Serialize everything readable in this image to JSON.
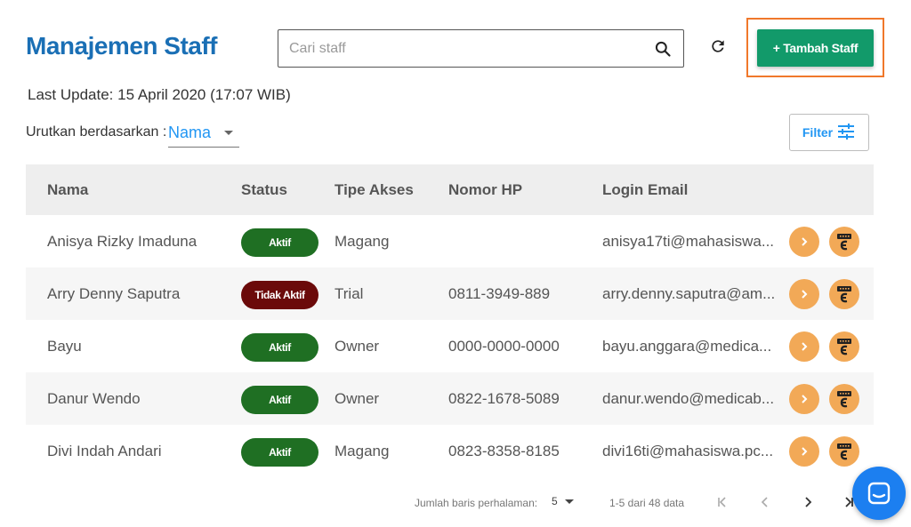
{
  "header": {
    "title": "Manajemen Staff",
    "search_placeholder": "Cari staff",
    "add_button": "+ Tambah Staff"
  },
  "last_update": "Last Update: 15 April 2020 (17:07 WIB)",
  "sort": {
    "label": "Urutkan berdasarkan :",
    "value": "Nama"
  },
  "filter_label": "Filter",
  "table": {
    "columns": [
      "Nama",
      "Status",
      "Tipe Akses",
      "Nomor HP",
      "Login Email"
    ],
    "rows": [
      {
        "name": "Anisya Rizky Imaduna",
        "status": "Aktif",
        "status_type": "active",
        "akses": "Magang",
        "hp": "",
        "email": "anisya17ti@mahasiswa..."
      },
      {
        "name": "Arry Denny Saputra",
        "status": "Tidak Aktif",
        "status_type": "inactive",
        "akses": "Trial",
        "hp": "0811-3949-889",
        "email": "arry.denny.saputra@am..."
      },
      {
        "name": "Bayu",
        "status": "Aktif",
        "status_type": "active",
        "akses": "Owner",
        "hp": "0000-0000-0000",
        "email": "bayu.anggara@medica..."
      },
      {
        "name": "Danur Wendo",
        "status": "Aktif",
        "status_type": "active",
        "akses": "Owner",
        "hp": "0822-1678-5089",
        "email": "danur.wendo@medicab..."
      },
      {
        "name": "Divi Indah Andari",
        "status": "Aktif",
        "status_type": "active",
        "akses": "Magang",
        "hp": "0823-8358-8185",
        "email": "divi16ti@mahasiswa.pc..."
      }
    ]
  },
  "pagination": {
    "rows_label": "Jumlah baris perhalaman:",
    "rows_value": "5",
    "range": "1-5 dari 48 data"
  },
  "colors": {
    "title": "#1a6fb5",
    "primary_button": "#129a6a",
    "highlight": "#f0782b",
    "active_badge": "#1f6f23",
    "inactive_badge": "#6b0a0a",
    "action_button": "#f2a957",
    "link": "#2196f3"
  },
  "icons": [
    "search-icon",
    "refresh-icon",
    "filter-icon",
    "chevron-right-icon",
    "edc-icon",
    "first-page-icon",
    "prev-page-icon",
    "next-page-icon",
    "last-page-icon",
    "chat-icon"
  ]
}
